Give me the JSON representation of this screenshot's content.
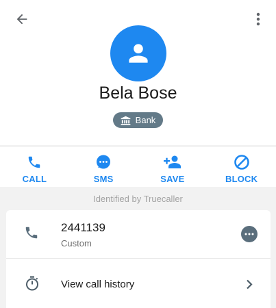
{
  "contact": {
    "name": "Bela Bose",
    "tag_label": "Bank"
  },
  "actions": [
    {
      "label": "CALL",
      "icon": "phone-icon"
    },
    {
      "label": "SMS",
      "icon": "sms-icon"
    },
    {
      "label": "SAVE",
      "icon": "add-person-icon"
    },
    {
      "label": "BLOCK",
      "icon": "block-icon"
    }
  ],
  "identified_text": "Identified by Truecaller",
  "phone": {
    "number": "2441139",
    "type": "Custom"
  },
  "history": {
    "label": "View call history"
  },
  "colors": {
    "accent": "#1e88f0",
    "tag_bg": "#637a88",
    "message_bubble": "#5a6e7c"
  }
}
